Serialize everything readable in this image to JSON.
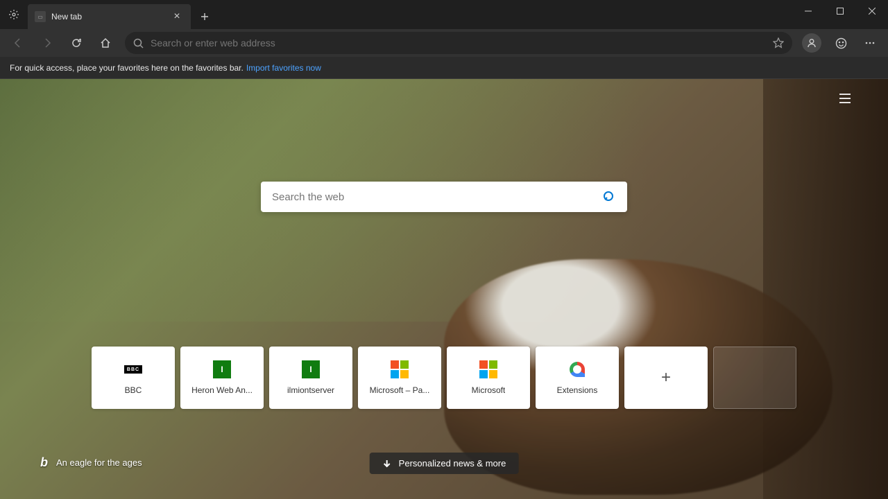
{
  "tab": {
    "title": "New tab"
  },
  "toolbar": {
    "address_placeholder": "Search or enter web address"
  },
  "favbar": {
    "text": "For quick access, place your favorites here on the favorites bar.",
    "link": "Import favorites now"
  },
  "ntp": {
    "search_placeholder": "Search the web",
    "tiles": [
      {
        "label": "BBC",
        "icon": "bbc"
      },
      {
        "label": "Heron Web An...",
        "icon": "green"
      },
      {
        "label": "ilmiontserver",
        "icon": "green"
      },
      {
        "label": "Microsoft – Pa...",
        "icon": "ms"
      },
      {
        "label": "Microsoft",
        "icon": "ms"
      },
      {
        "label": "Extensions",
        "icon": "ext"
      }
    ],
    "caption": "An eagle for the ages",
    "news_button": "Personalized news & more"
  }
}
